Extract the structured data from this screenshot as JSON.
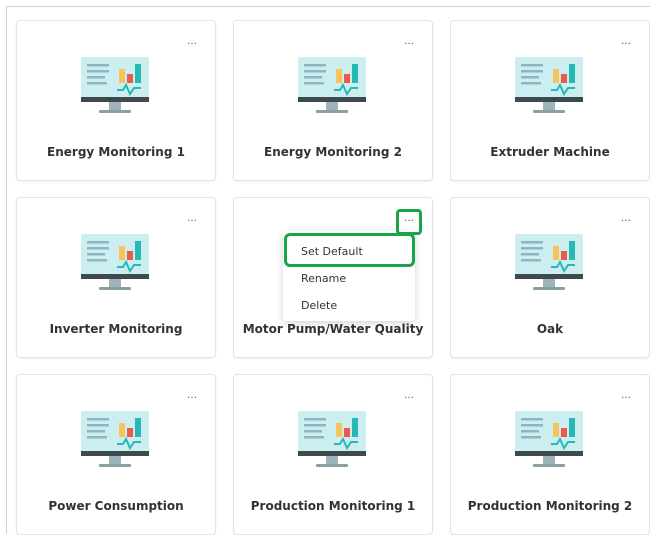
{
  "dashboards": [
    {
      "title": "Energy Monitoring 1",
      "menu_icon": "…",
      "icon": "monitor-chart-icon"
    },
    {
      "title": "Energy Monitoring 2",
      "menu_icon": "…",
      "icon": "monitor-chart-icon"
    },
    {
      "title": "Extruder Machine",
      "menu_icon": "…",
      "icon": "monitor-chart-icon"
    },
    {
      "title": "Inverter Monitoring",
      "menu_icon": "…",
      "icon": "monitor-chart-icon"
    },
    {
      "title": "Motor Pump/Water Quality",
      "menu_icon": "…",
      "icon": "monitor-chart-icon"
    },
    {
      "title": "Oak",
      "menu_icon": "…",
      "icon": "monitor-chart-icon"
    },
    {
      "title": "Power Consumption",
      "menu_icon": "…",
      "icon": "monitor-chart-icon"
    },
    {
      "title": "Production Monitoring 1",
      "menu_icon": "…",
      "icon": "monitor-chart-icon"
    },
    {
      "title": "Production Monitoring 2",
      "menu_icon": "…",
      "icon": "monitor-chart-icon"
    }
  ],
  "context_menu": {
    "items": [
      "Set Default",
      "Rename",
      "Delete"
    ]
  },
  "colors": {
    "highlight": "#1aa34a",
    "screen": "#cdeef1",
    "bar_yellow": "#f7c35a",
    "bar_red": "#ec5b47",
    "bar_teal": "#27b9b5",
    "bezel": "#3d4a4f"
  }
}
